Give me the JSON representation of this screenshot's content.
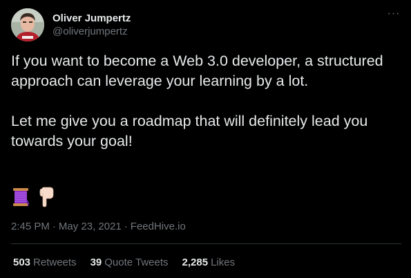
{
  "author": {
    "display_name": "Oliver Jumpertz",
    "handle": "@oliverjumpertz",
    "avatar_icon": "avatar-photo"
  },
  "more_icon": "ellipsis-icon",
  "more_glyph": "···",
  "tweet": {
    "text": "If you want to become a Web 3.0 developer, a structured approach can leverage your learning by a lot.\n\nLet me give you a roadmap that will definitely lead you towards your goal!",
    "emojis": [
      "thread-spool-icon",
      "pointing-down-icon"
    ]
  },
  "meta": {
    "time": "2:45 PM",
    "separator": "·",
    "date": "May 23, 2021",
    "source": "FeedHive.io"
  },
  "stats": {
    "retweets": {
      "count": "503",
      "label": "Retweets"
    },
    "quote_tweets": {
      "count": "39",
      "label": "Quote Tweets"
    },
    "likes": {
      "count": "2,285",
      "label": "Likes"
    }
  },
  "colors": {
    "background": "#000000",
    "text_primary": "#e7e9ea",
    "text_secondary": "#71767b",
    "divider": "#2f3336",
    "spool_purple": "#8b2fc9"
  }
}
